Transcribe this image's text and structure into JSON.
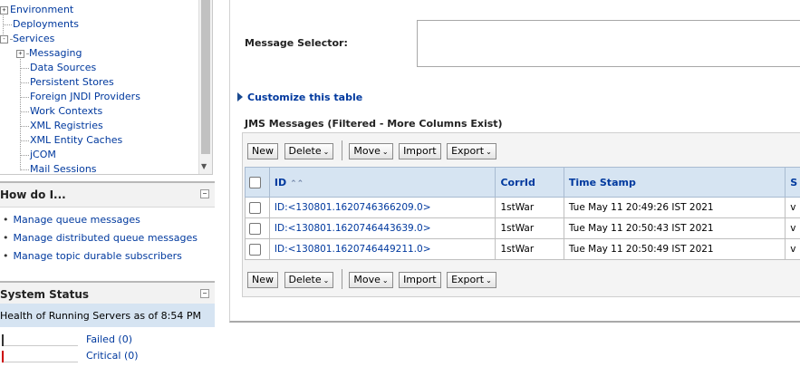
{
  "tree": {
    "items": [
      {
        "label": "Environment",
        "toggle": "+"
      },
      {
        "label": "Deployments",
        "toggle": ""
      },
      {
        "label": "Services",
        "toggle": "-"
      },
      {
        "label": "Messaging",
        "toggle": "+"
      },
      {
        "label": "Data Sources",
        "toggle": ""
      },
      {
        "label": "Persistent Stores",
        "toggle": ""
      },
      {
        "label": "Foreign JNDI Providers",
        "toggle": ""
      },
      {
        "label": "Work Contexts",
        "toggle": ""
      },
      {
        "label": "XML Registries",
        "toggle": ""
      },
      {
        "label": "XML Entity Caches",
        "toggle": ""
      },
      {
        "label": "jCOM",
        "toggle": ""
      },
      {
        "label": "Mail Sessions",
        "toggle": ""
      }
    ]
  },
  "howdo": {
    "title": "How do I...",
    "items": [
      "Manage queue messages",
      "Manage distributed queue messages",
      "Manage topic durable subscribers"
    ]
  },
  "system_status": {
    "title": "System Status",
    "health_text": "Health of Running Servers as of  8:54 PM",
    "rows": [
      {
        "label": "Failed (0)",
        "color": "#333333"
      },
      {
        "label": "Critical (0)",
        "color": "#cc0000"
      }
    ]
  },
  "content": {
    "message_selector_label": "Message Selector:",
    "customize_label": "Customize this table",
    "table_title": "JMS Messages (Filtered - More Columns Exist)",
    "toolbar": {
      "new": "New",
      "delete": "Delete",
      "move": "Move",
      "import": "Import",
      "export": "Export"
    },
    "columns": {
      "id": "ID",
      "corrid": "CorrId",
      "timestamp": "Time Stamp",
      "next": "S"
    },
    "rows": [
      {
        "id": "ID:<130801.1620746366209.0>",
        "corrid": "1stWar",
        "timestamp": "Tue May 11 20:49:26 IST 2021",
        "next": "v"
      },
      {
        "id": "ID:<130801.1620746443639.0>",
        "corrid": "1stWar",
        "timestamp": "Tue May 11 20:50:43 IST 2021",
        "next": "v"
      },
      {
        "id": "ID:<130801.1620746449211.0>",
        "corrid": "1stWar",
        "timestamp": "Tue May 11 20:50:49 IST 2021",
        "next": "v"
      }
    ]
  }
}
